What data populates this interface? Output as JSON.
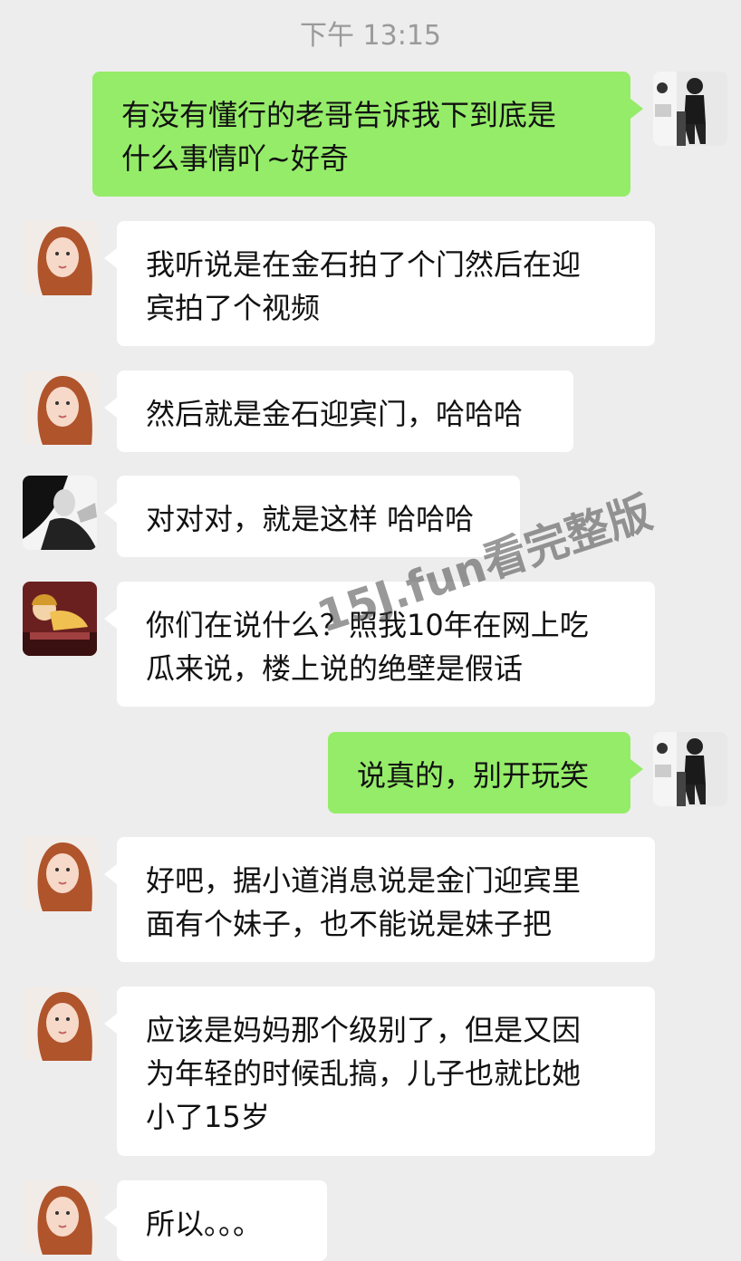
{
  "timestamp": "下午 13:15",
  "watermark": "15J.fun看完整版",
  "messages": [
    {
      "side": "out",
      "avatar": "self",
      "text": "有没有懂行的老哥告诉我下到底是\n什么事情吖~好奇"
    },
    {
      "side": "in",
      "avatar": "girl-red-hair",
      "text": "我听说是在金石拍了个门然后在迎\n宾拍了个视频"
    },
    {
      "side": "in",
      "avatar": "girl-red-hair",
      "text": "然后就是金石迎宾门，哈哈哈"
    },
    {
      "side": "in",
      "avatar": "girl-black-white",
      "text": "对对对，就是这样 哈哈哈"
    },
    {
      "side": "in",
      "avatar": "cartoon-girl",
      "text": "你们在说什么？照我10年在网上吃\n瓜来说，楼上说的绝壁是假话"
    },
    {
      "side": "out",
      "avatar": "self",
      "text": "说真的，别开玩笑"
    },
    {
      "side": "in",
      "avatar": "girl-red-hair",
      "text": "好吧，据小道消息说是金门迎宾里\n面有个妹子，也不能说是妹子把"
    },
    {
      "side": "in",
      "avatar": "girl-red-hair",
      "text": "应该是妈妈那个级别了，但是又因\n为年轻的时候乱搞，儿子也就比她\n小了15岁"
    },
    {
      "side": "in",
      "avatar": "girl-red-hair",
      "text": "所以。。。"
    }
  ]
}
